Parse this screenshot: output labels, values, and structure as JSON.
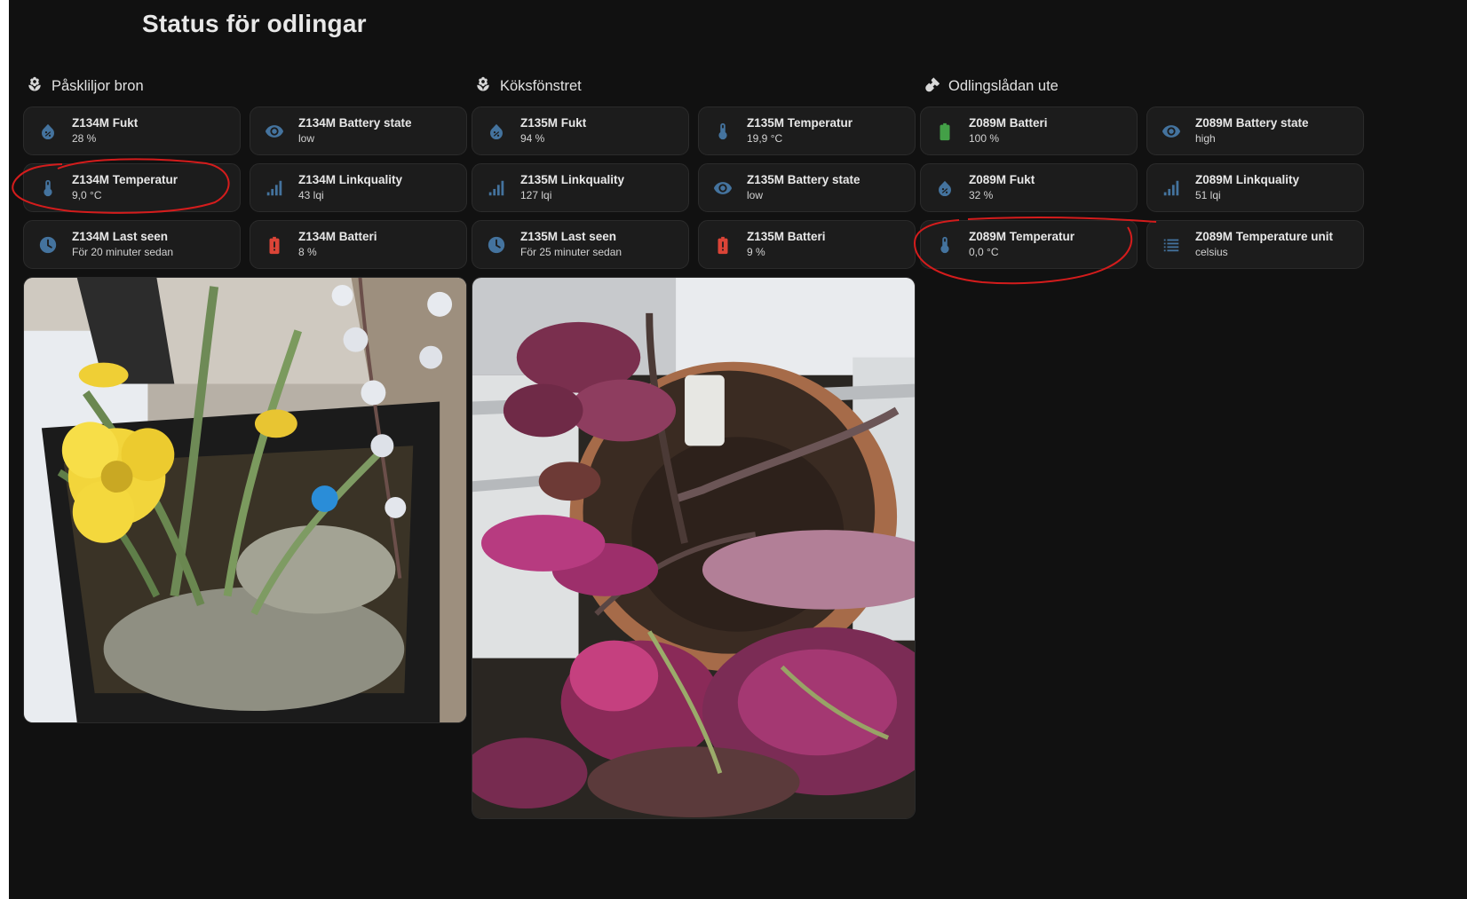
{
  "page": {
    "title": "Status för odlingar"
  },
  "colors": {
    "background": "#111111",
    "tile": "#1c1c1c",
    "icon_blue": "#44739e",
    "battery_green": "#43a047",
    "battery_red": "#db4437",
    "annotation_red": "#d41c1c"
  },
  "columns": [
    {
      "title": "Påskliljor bron",
      "icon": "flower-icon",
      "tiles": [
        {
          "name": "Z134M Fukt",
          "state": "28 %",
          "icon": "water-percent-icon"
        },
        {
          "name": "Z134M Battery state",
          "state": "low",
          "icon": "eye-icon"
        },
        {
          "name": "Z134M Temperatur",
          "state": "9,0 °C",
          "icon": "thermometer-icon"
        },
        {
          "name": "Z134M Linkquality",
          "state": "43 lqi",
          "icon": "signal-icon"
        },
        {
          "name": "Z134M Last seen",
          "state": "För 20 minuter sedan",
          "icon": "clock-icon"
        },
        {
          "name": "Z134M Batteri",
          "state": "8 %",
          "icon": "battery-alert-icon"
        }
      ],
      "photo": "daffodil-planter-photo"
    },
    {
      "title": "Köksfönstret",
      "icon": "flower-icon",
      "tiles": [
        {
          "name": "Z135M Fukt",
          "state": "94 %",
          "icon": "water-percent-icon"
        },
        {
          "name": "Z135M Temperatur",
          "state": "19,9 °C",
          "icon": "thermometer-icon"
        },
        {
          "name": "Z135M Linkquality",
          "state": "127 lqi",
          "icon": "signal-icon"
        },
        {
          "name": "Z135M Battery state",
          "state": "low",
          "icon": "eye-icon"
        },
        {
          "name": "Z135M Last seen",
          "state": "För 25 minuter sedan",
          "icon": "clock-icon"
        },
        {
          "name": "Z135M Batteri",
          "state": "9 %",
          "icon": "battery-alert-icon"
        }
      ],
      "photo": "coleus-pot-photo"
    },
    {
      "title": "Odlingslådan ute",
      "icon": "shovel-icon",
      "tiles": [
        {
          "name": "Z089M Batteri",
          "state": "100 %",
          "icon": "battery-full-icon"
        },
        {
          "name": "Z089M Battery state",
          "state": "high",
          "icon": "eye-icon"
        },
        {
          "name": "Z089M Fukt",
          "state": "32 %",
          "icon": "water-percent-icon"
        },
        {
          "name": "Z089M Linkquality",
          "state": "51 lqi",
          "icon": "signal-icon"
        },
        {
          "name": "Z089M Temperatur",
          "state": "0,0 °C",
          "icon": "thermometer-icon"
        },
        {
          "name": "Z089M Temperature unit",
          "state": "celsius",
          "icon": "list-icon"
        }
      ]
    }
  ]
}
